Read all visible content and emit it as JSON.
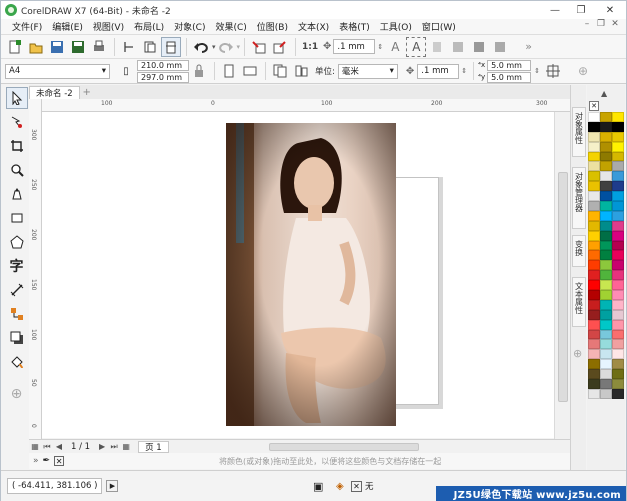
{
  "window": {
    "title": "CorelDRAW X7 (64-Bit) - 未命名 -2",
    "controls": {
      "minimize": "—",
      "maximize": "❐",
      "close": "✕"
    }
  },
  "menubar": {
    "items": [
      "文件(F)",
      "编辑(E)",
      "视图(V)",
      "布局(L)",
      "对象(C)",
      "效果(C)",
      "位图(B)",
      "文本(X)",
      "表格(T)",
      "工具(O)",
      "窗口(W)"
    ]
  },
  "toolbar_standard": {
    "nudge_value": ".1 mm",
    "more": "»"
  },
  "property_bar": {
    "page_size": "A4",
    "width": "210.0 mm",
    "height": "297.0 mm",
    "units_label": "单位:",
    "units_value": "毫米",
    "nudge_value": ".1 mm",
    "dup_x": "5.0 mm",
    "dup_y": "5.0 mm"
  },
  "document_tabs": [
    {
      "label": "未命名 -2"
    }
  ],
  "rulers": {
    "v_labels": [
      "300",
      "250",
      "200",
      "150",
      "100",
      "50",
      "0"
    ],
    "h_labels": [
      "100",
      "0",
      "100",
      "200",
      "300"
    ]
  },
  "page_nav": {
    "page_indicator": "1 / 1",
    "page_tab": "页 1"
  },
  "color_hint": {
    "text": "将颜色(或对象)拖动至此处，以便将这些颜色与文档存储在一起"
  },
  "status": {
    "coordinates": "( -64.411, 381.106 )",
    "fill_label": "无",
    "watermark": "JZ5U绿色下载站 www.jz5u.com"
  },
  "dockers": {
    "tabs": [
      "对象属性",
      "对象管理器",
      "变换",
      "文本属性"
    ]
  },
  "palette": {
    "colors": [
      "#ffffff",
      "#c8a400",
      "#ffe600",
      "#000000",
      "#1a1a1a",
      "#000000",
      "#f0e6b0",
      "#d9b000",
      "#e8c800",
      "#f6f0c8",
      "#b09000",
      "#fff200",
      "#f4d300",
      "#8e7a00",
      "#d4b800",
      "#ece0a0",
      "#c2a200",
      "#aaaaaa",
      "#d9c000",
      "#e6e6e6",
      "#3a9ad9",
      "#eac200",
      "#404040",
      "#1e3c8c",
      "#e8e8e8",
      "#0050a0",
      "#00a0e0",
      "#b0b0b0",
      "#00b4a0",
      "#0096d6",
      "#ffb400",
      "#00b4ff",
      "#2ca0e0",
      "#e2b800",
      "#008c8c",
      "#e03c8c",
      "#ffd000",
      "#006e46",
      "#d80080",
      "#ffa000",
      "#00965a",
      "#b40050",
      "#ff6a00",
      "#008040",
      "#e8005a",
      "#ff3c00",
      "#8cc83c",
      "#c8006e",
      "#e02020",
      "#50b43c",
      "#e6327d",
      "#ff0000",
      "#c8e650",
      "#ff6496",
      "#b40000",
      "#a0d232",
      "#ff8cb4",
      "#c81e1e",
      "#00b4b4",
      "#ffb4c8",
      "#961e1e",
      "#00a0a0",
      "#e6c8d2",
      "#ff5050",
      "#00c8c8",
      "#ff96aa",
      "#d24646",
      "#78c8dc",
      "#fa6e6e",
      "#e67878",
      "#96dcdc",
      "#f0a0a0",
      "#f5b4b4",
      "#c8e6f0",
      "#ffe6e6",
      "#8c6e00",
      "#e6f5ff",
      "#a08c46",
      "#5a4a1e",
      "#dcdcdc",
      "#6e6e14",
      "#3c3c1e",
      "#787878",
      "#8c8c3c",
      "#e6e6e6",
      "#c8c8c8",
      "#282828"
    ]
  }
}
